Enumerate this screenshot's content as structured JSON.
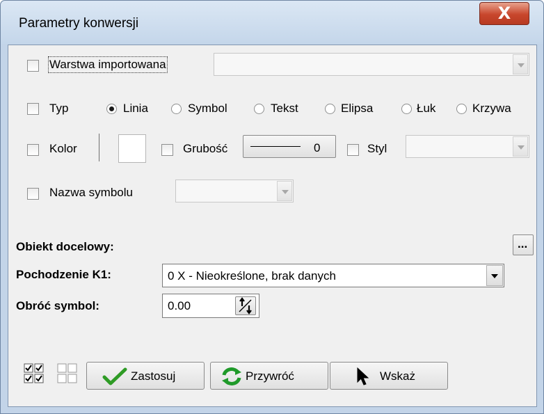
{
  "window": {
    "title": "Parametry konwersji",
    "close_glyph": "X"
  },
  "row_layer": {
    "label": "Warstwa importowana",
    "value": ""
  },
  "row_type": {
    "label": "Typ",
    "options": [
      "Linia",
      "Symbol",
      "Tekst",
      "Elipsa",
      "Łuk",
      "Krzywa"
    ],
    "selected": "Linia"
  },
  "row_color": {
    "label": "Kolor",
    "thickness_label": "Grubość",
    "thickness_value": "0",
    "style_label": "Styl",
    "style_value": ""
  },
  "row_symbol": {
    "label": "Nazwa symbolu",
    "value": ""
  },
  "target": {
    "label": "Obiekt docelowy:",
    "browse_label": "..."
  },
  "origin": {
    "label": "Pochodzenie K1:",
    "value": "0 X - Nieokreślone, brak danych"
  },
  "rotate": {
    "label": "Obróć symbol:",
    "value": "0.00"
  },
  "buttons": {
    "apply": "Zastosuj",
    "restore": "Przywróć",
    "point": "Wskaż"
  },
  "icons": {
    "select_all": "check-all-icon",
    "deselect_all": "uncheck-all-icon",
    "apply": "checkmark-icon",
    "restore": "refresh-icon",
    "point": "cursor-arrow-icon",
    "spin": "spin-arrows-icon"
  },
  "colors": {
    "close_button": "#c8462c",
    "apply_check": "#2e9b25",
    "restore_arrows": "#1f9a2a"
  }
}
